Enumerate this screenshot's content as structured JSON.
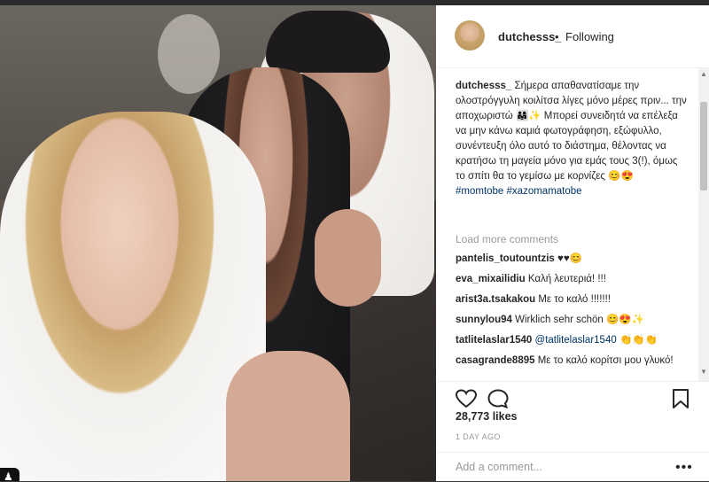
{
  "post": {
    "username": "dutchesss_",
    "separator": "•",
    "follow_label": "Following",
    "caption": {
      "author": "dutchesss_",
      "text": "Σήμερα απαθανατίσαμε την ολοστρόγγυλη κοιλίτσα λίγες μόνο μέρες πριν... την αποχωριστώ 👨‍👩‍👧✨ Μπορεί συνειδητά να επέλεξα να μην κάνω καμιά φωτογράφηση, εξώφυλλο, συνέντευξη όλο αυτό το διάστημα, θέλοντας να κρατήσω τη μαγεία μόνο για εμάς τους 3(!), όμως το σπίτι θα το γεμίσω με κορνίζες 😊😍",
      "hashtags": "#momtobe #xazomamatobe"
    },
    "load_more_label": "Load more comments",
    "comments": [
      {
        "user": "pantelis_toutountzis",
        "text": "♥♥😊"
      },
      {
        "user": "eva_mixailidiu",
        "text": "Καλή λευτεριά! !!!"
      },
      {
        "user": "arist3a.tsakakou",
        "text": "Με το καλό !!!!!!!"
      },
      {
        "user": "sunnylou94",
        "text": "Wirklich sehr schön 😊😍✨"
      },
      {
        "user": "tatlitelaslar1540",
        "mention": "@tatlitelaslar1540",
        "text": "👏👏👏"
      },
      {
        "user": "casagrande8895",
        "text": "Με το καλό κορίτσι μου γλυκό!"
      }
    ],
    "likes": "28,773 likes",
    "timestamp": "1 DAY AGO",
    "comment_placeholder": "Add a comment...",
    "more_label": "•••"
  },
  "icons": {
    "heart": "heart-icon",
    "comment": "comment-icon",
    "bookmark": "bookmark-icon",
    "collection": "collection-icon"
  },
  "colors": {
    "text": "#262626",
    "muted": "#999999",
    "link": "#003569",
    "border": "#efefef"
  }
}
